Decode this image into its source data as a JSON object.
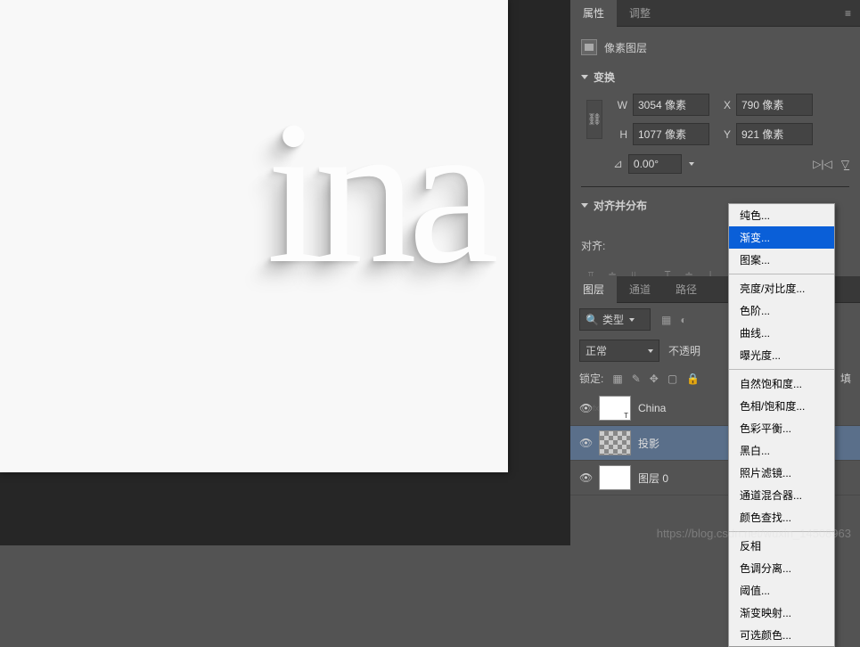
{
  "canvas": {
    "text": "ina"
  },
  "properties": {
    "tabs": {
      "properties": "属性",
      "adjustments": "调整"
    },
    "layer_type": "像素图层",
    "transform": {
      "title": "变换",
      "w_label": "W",
      "w_value": "3054 像素",
      "h_label": "H",
      "h_value": "1077 像素",
      "x_label": "X",
      "x_value": "790 像素",
      "y_label": "Y",
      "y_value": "921 像素",
      "rotation": "0.00°"
    },
    "align": {
      "title": "对齐并分布",
      "label": "对齐:"
    }
  },
  "layers_panel": {
    "tabs": {
      "layers": "图层",
      "channels": "通道",
      "paths": "路径"
    },
    "filter_label": "类型",
    "blend_mode": "正常",
    "opacity_label": "不透明",
    "lock_label": "锁定:",
    "fill_label": "填",
    "items": [
      {
        "name": "China"
      },
      {
        "name": "投影"
      },
      {
        "name": "图层 0"
      }
    ]
  },
  "context_menu": {
    "group1": [
      "纯色...",
      "渐变...",
      "图案..."
    ],
    "group2": [
      "亮度/对比度...",
      "色阶...",
      "曲线...",
      "曝光度..."
    ],
    "group3": [
      "自然饱和度...",
      "色相/饱和度...",
      "色彩平衡...",
      "黑白...",
      "照片滤镜...",
      "通道混合器...",
      "颜色查找..."
    ],
    "group4": [
      "反相",
      "色调分离...",
      "阈值...",
      "渐变映射...",
      "可选颜色..."
    ]
  },
  "watermark": "https://blog.csdn.net/wuxin_14508963"
}
